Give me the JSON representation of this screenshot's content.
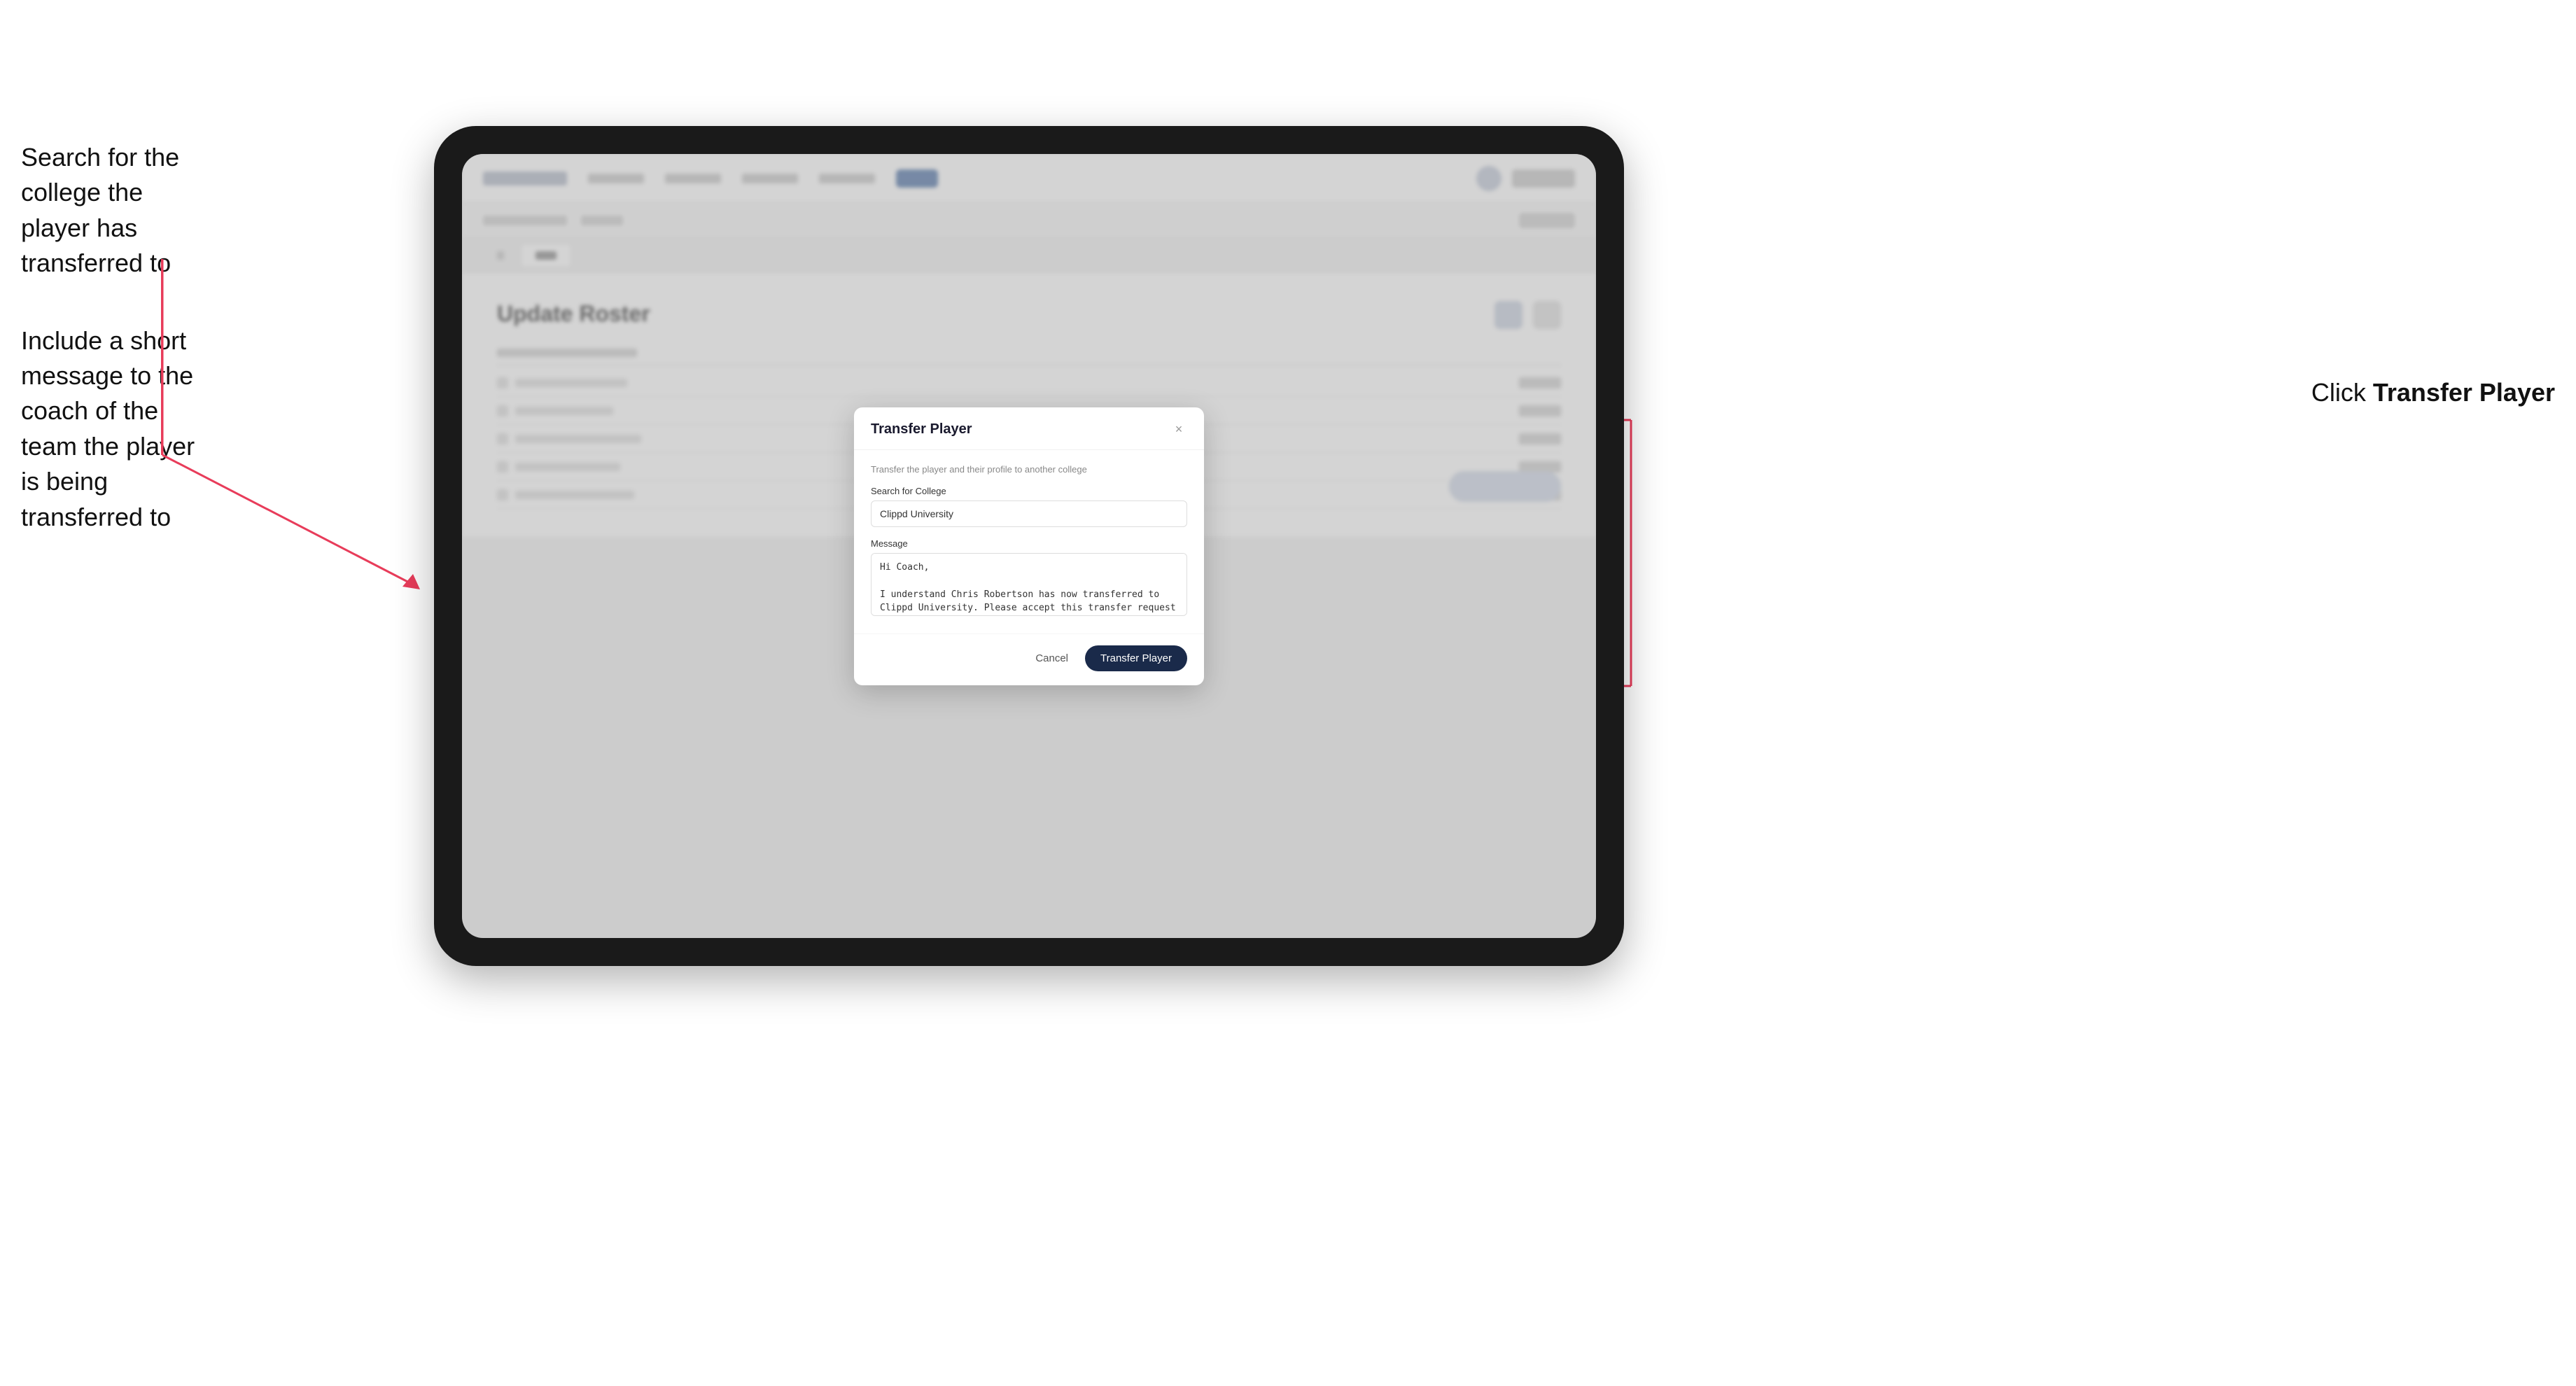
{
  "annotations": {
    "left_top": "Search for the college the player has transferred to",
    "left_bottom": "Include a short message to the coach of the team the player is being transferred to",
    "right": "Click ",
    "right_bold": "Transfer Player"
  },
  "modal": {
    "title": "Transfer Player",
    "description": "Transfer the player and their profile to another college",
    "search_label": "Search for College",
    "search_value": "Clippd University",
    "message_label": "Message",
    "message_value": "Hi Coach,\n\nI understand Chris Robertson has now transferred to Clippd University. Please accept this transfer request when you can.",
    "cancel_label": "Cancel",
    "transfer_label": "Transfer Player",
    "close_icon": "×"
  },
  "nav": {
    "logo_alt": "Clippd logo",
    "active_tab": "Roster",
    "page_title": "Update Roster"
  }
}
